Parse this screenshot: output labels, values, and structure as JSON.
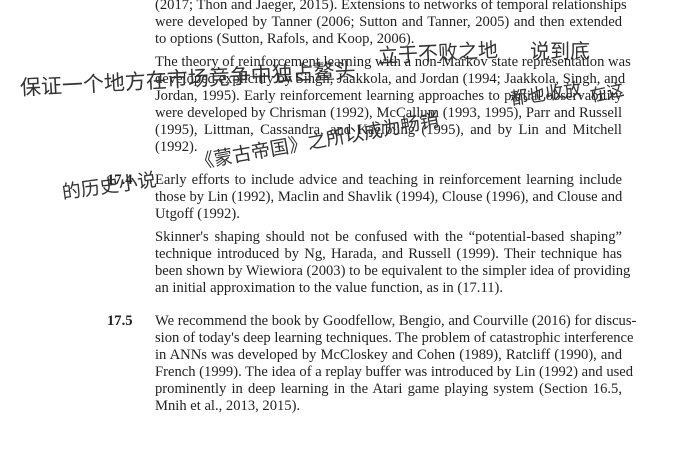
{
  "sections": [
    {
      "number": "",
      "paragraphs": [
        [
          "(2017; Thon and Jaeger, 2015). Extensions to networks of temporal relationships",
          "were developed by Tanner (2006; Sutton and Tanner, 2005) and then extended",
          "to options (Sutton, Rafols, and Koop, 2006)."
        ],
        [
          "The theory of reinforcement learning with a non-Markov state representation was",
          "developed explicitly by Singh, Jaakkola, and Jordan (1994; Jaakkola, Singh, and",
          "Jordan, 1995). Early reinforcement learning approaches to partial observability",
          "were developed by Chrisman (1992), McCallum (1993, 1995), Parr and Russell",
          "(1995), Littman, Cassandra, and Kaelbling (1995), and by Lin and Mitchell",
          "(1992)."
        ]
      ]
    },
    {
      "number": "17.4",
      "paragraphs": [
        [
          "Early efforts to include advice and teaching in reinforcement learning include",
          "those by Lin (1992), Maclin and Shavlik (1994), Clouse (1996), and Clouse and",
          "Utgoff (1992)."
        ],
        [
          "Skinner's shaping should not be confused with the “potential-based shaping”",
          "technique introduced by Ng, Harada, and Russell (1999). Their technique has",
          "been shown by Wiewiora (2003) to be equivalent to the simpler idea of providing",
          "an initial approximation to the value function, as in (17.11)."
        ]
      ]
    },
    {
      "number": "17.5",
      "paragraphs": [
        [
          "We recommend the book by Goodfellow, Bengio, and Courville (2016) for discus-",
          "sion of today's deep learning techniques. The problem of catastrophic interference",
          "in ANNs was developed by McCloskey and Cohen (1989), Ratcliff (1990), and",
          "French (1999). The idea of a replay buffer was introduced by Lin (1992) and used",
          "prominently in deep learning in the Atari game playing system (Section 16.5,",
          "Mnih et al., 2013, 2015)."
        ]
      ]
    }
  ],
  "handwriting": [
    "保证一个地方在市场竞争中独占鳌头",
    "立于不败之地",
    "说到底",
    "都也收放",
    "在这",
    "《蒙古帝国》之所以成为畅销",
    "的历史小说"
  ]
}
